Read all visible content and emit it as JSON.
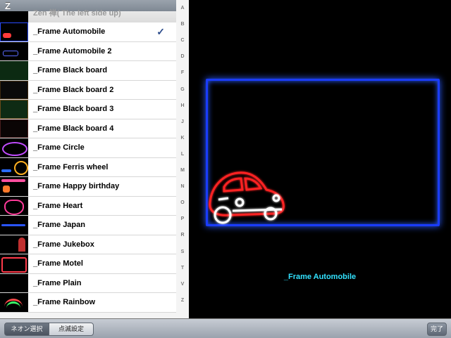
{
  "list": {
    "section_letter": "Z",
    "faded_item": "Zen 禅( The left side up)",
    "items": [
      {
        "label": "_Frame Automobile",
        "selected": true
      },
      {
        "label": "_Frame Automobile 2"
      },
      {
        "label": "_Frame Black board"
      },
      {
        "label": "_Frame Black board 2"
      },
      {
        "label": "_Frame Black board 3"
      },
      {
        "label": "_Frame Black board 4"
      },
      {
        "label": "_Frame Circle"
      },
      {
        "label": "_Frame Ferris wheel"
      },
      {
        "label": "_Frame Happy birthday"
      },
      {
        "label": "_Frame Heart"
      },
      {
        "label": "_Frame Japan"
      },
      {
        "label": "_Frame Jukebox"
      },
      {
        "label": "_Frame Motel"
      },
      {
        "label": "_Frame Plain"
      },
      {
        "label": "_Frame Rainbow"
      }
    ],
    "checkmark": "✓"
  },
  "index_letters": [
    "A",
    "B",
    "C",
    "D",
    "F",
    "G",
    "H",
    "J",
    "K",
    "L",
    "M",
    "N",
    "O",
    "P",
    "R",
    "S",
    "T",
    "V",
    "Z"
  ],
  "preview": {
    "title": "_Frame Automobile",
    "frame_color": "#1a3cff",
    "title_color": "#32e2ff"
  },
  "toolbar": {
    "tab_neon_select": "ネオン選択",
    "tab_blink_settings": "点滅設定",
    "done": "完了"
  }
}
